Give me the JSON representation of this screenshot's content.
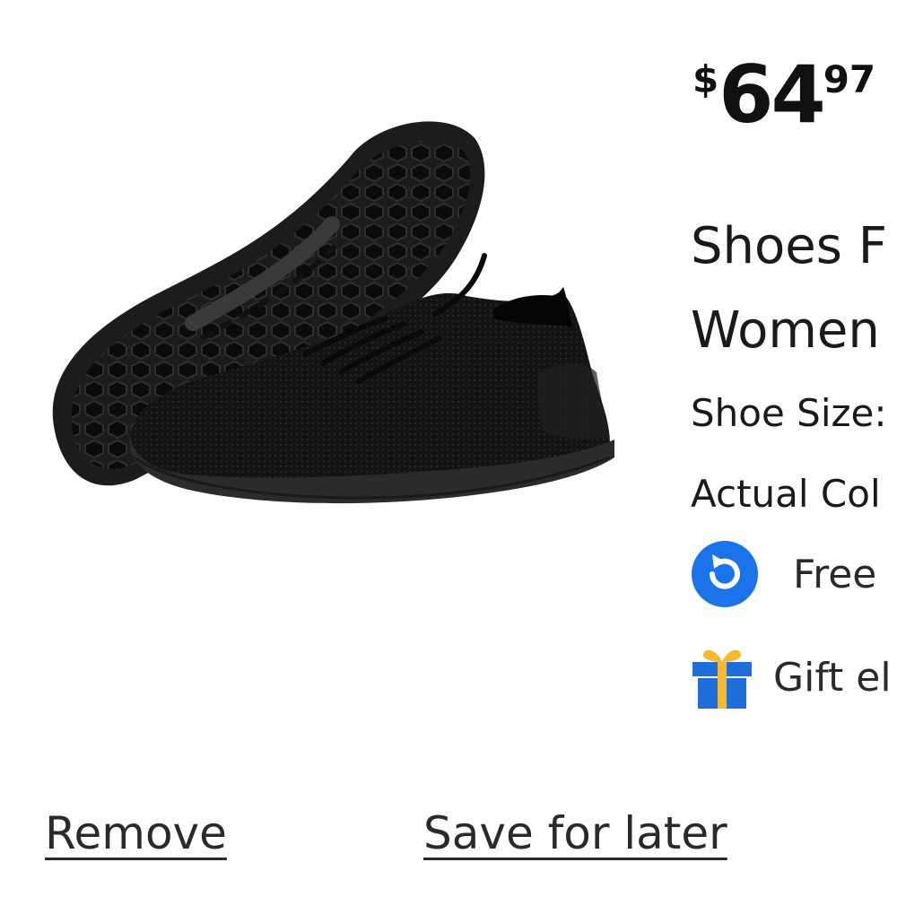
{
  "product": {
    "image_alt": "Black knit sneakers",
    "price": {
      "currency": "$",
      "dollars": "64",
      "cents": "97"
    },
    "title_lines": [
      "Shoes F",
      "Women"
    ],
    "shoe_size_label": "Shoe Size:",
    "actual_color_label": "Actual Col",
    "free_returns_label": "Free",
    "gift_label": "Gift el"
  },
  "actions": {
    "remove_label": "Remove",
    "save_label": "Save for later"
  },
  "colors": {
    "accent_blue": "#1a73e8",
    "gift_blue": "#1e6fd9",
    "gift_yellow": "#f5b82e"
  }
}
